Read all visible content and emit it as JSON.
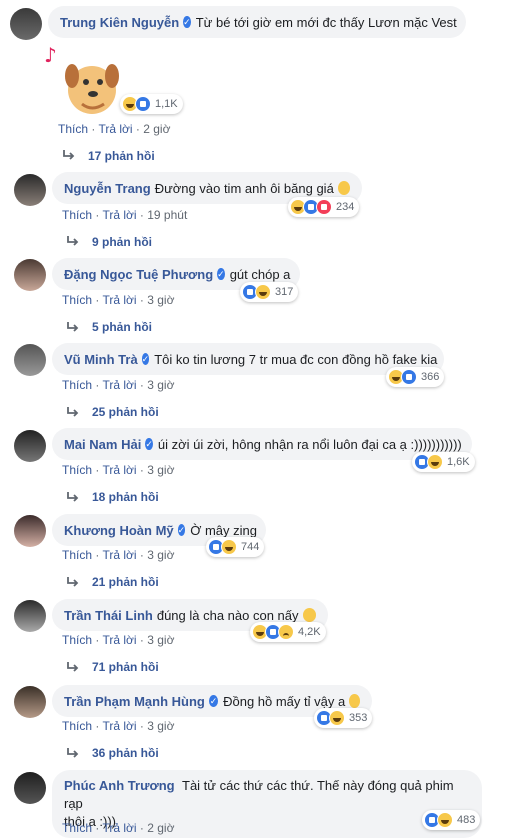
{
  "comments": [
    {
      "name": "Trung Kiên Nguyễn",
      "verified": true,
      "text": "Từ bé tới giờ em mới đc thấy Lươn mặc Vest",
      "like": "Thích",
      "reply": "Trả lời",
      "time": "2 giờ",
      "reaction_count": "1,1K",
      "replies": "17 phản hồi"
    },
    {
      "name": "Nguyễn Trang",
      "verified": false,
      "text": "Đường vào tim anh ôi băng giá",
      "like": "Thích",
      "reply": "Trả lời",
      "time": "19 phút",
      "reaction_count": "234",
      "replies": "9 phản hồi"
    },
    {
      "name": "Đặng Ngọc Tuệ Phương",
      "verified": true,
      "text": "gút chóp a",
      "like": "Thích",
      "reply": "Trả lời",
      "time": "3 giờ",
      "reaction_count": "317",
      "replies": "5 phản hồi"
    },
    {
      "name": "Vũ Minh Trà",
      "verified": true,
      "text": "Tôi ko tin lương 7 tr mua đc con đồng hồ fake kia",
      "like": "Thích",
      "reply": "Trả lời",
      "time": "3 giờ",
      "reaction_count": "366",
      "replies": "25 phản hồi"
    },
    {
      "name": "Mai Nam Hải",
      "verified": true,
      "text": "úi zời úi zời, hông nhận ra nổi luôn đại ca ạ :)))))))))))",
      "like": "Thích",
      "reply": "Trả lời",
      "time": "3 giờ",
      "reaction_count": "1,6K",
      "replies": "18 phản hồi"
    },
    {
      "name": "Khương Hoàn Mỹ",
      "verified": true,
      "text": "Ờ mây zing",
      "like": "Thích",
      "reply": "Trả lời",
      "time": "3 giờ",
      "reaction_count": "744",
      "replies": "21 phản hồi"
    },
    {
      "name": "Trần Thái Linh",
      "verified": false,
      "text": "đúng là cha nào con nấy",
      "like": "Thích",
      "reply": "Trả lời",
      "time": "3 giờ",
      "reaction_count": "4,2K",
      "replies": "71 phản hồi"
    },
    {
      "name": "Trần Phạm Mạnh Hùng",
      "verified": true,
      "text": "Đồng hồ mấy tỉ vậy a",
      "like": "Thích",
      "reply": "Trả lời",
      "time": "3 giờ",
      "reaction_count": "353",
      "replies": "36 phản hồi"
    },
    {
      "name": "Phúc Anh Trương",
      "verified": false,
      "text_line1": "Tài tử các thứ các thứ. Thế này đóng quả phim rạp",
      "text_line2": "thôi a :)))",
      "like": "Thích",
      "reply": "Trả lời",
      "time": "2 giờ",
      "reaction_count": "483"
    }
  ],
  "separator": " · ",
  "verified_glyph": "✓",
  "colors": {
    "name": "#385898",
    "bubble": "#f2f3f5",
    "like": "#3578e5",
    "haha": "#f7c84a"
  }
}
